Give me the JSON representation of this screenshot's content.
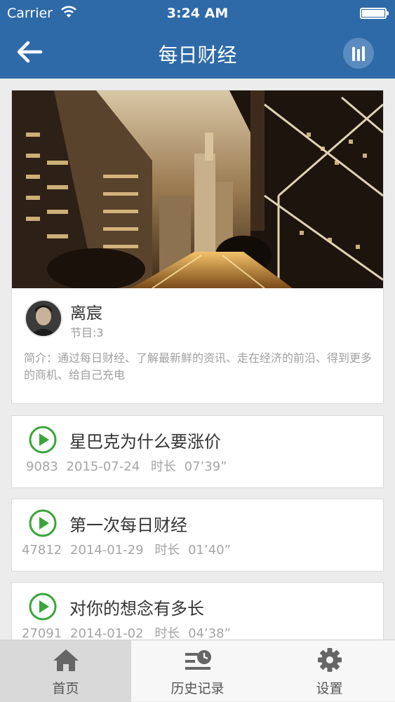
{
  "status_bar": {
    "carrier": "Carrier",
    "time": "3:24 AM"
  },
  "nav": {
    "title": "每日财经"
  },
  "header": {
    "author_name": "离宸",
    "episodes": "节目:3",
    "intro": "简介：通过每日财经、了解最新鲜的资讯、走在经济的前沿、得到更多的商机、给自己充电"
  },
  "episodes": [
    {
      "title": "星巴克为什么要涨价",
      "plays": "9083",
      "date": "2015-07-24",
      "duration_label": "时长",
      "duration": "07’39”"
    },
    {
      "title": "第一次每日财经",
      "plays": "47812",
      "date": "2014-01-29",
      "duration_label": "时长",
      "duration": "01’40”"
    },
    {
      "title": "对你的想念有多长",
      "plays": "27091",
      "date": "2014-01-02",
      "duration_label": "时长",
      "duration": "04’38”"
    }
  ],
  "tabs": [
    {
      "label": "首页",
      "icon": "home-icon",
      "active": true
    },
    {
      "label": "历史记录",
      "icon": "history-icon",
      "active": false
    },
    {
      "label": "设置",
      "icon": "gear-icon",
      "active": false
    }
  ],
  "colors": {
    "brand": "#2f6aa8",
    "play": "#3aa53a",
    "tab_active": "#d9d9d9"
  }
}
